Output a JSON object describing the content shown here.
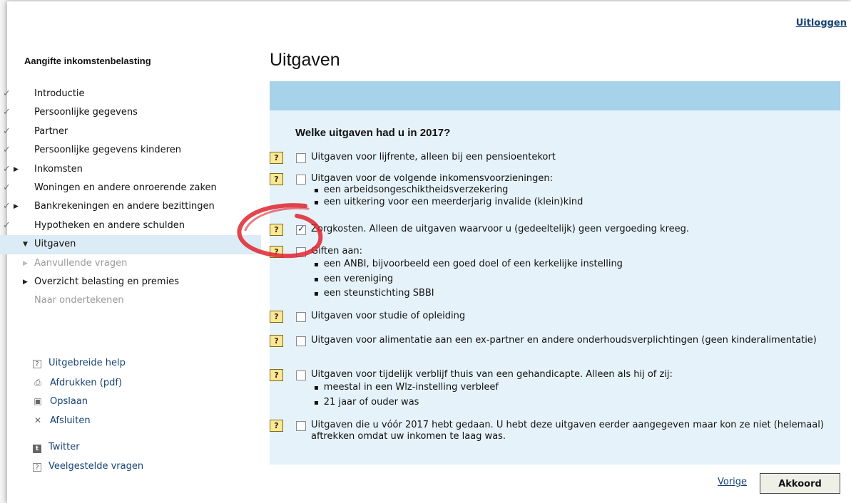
{
  "header": {
    "logout_label": "Uitloggen"
  },
  "sidebar": {
    "title": "Aangifte inkomstenbelasting",
    "items": [
      {
        "label": "Introductie",
        "check": "✓",
        "arrow": "",
        "state": "done"
      },
      {
        "label": "Persoonlijke gegevens",
        "check": "✓",
        "arrow": "",
        "state": "done"
      },
      {
        "label": "Partner",
        "check": "✓",
        "arrow": "",
        "state": "done"
      },
      {
        "label": "Persoonlijke gegevens kinderen",
        "check": "✓",
        "arrow": "",
        "state": "done"
      },
      {
        "label": "Inkomsten",
        "check": "✓",
        "arrow": "▶",
        "state": "done"
      },
      {
        "label": "Woningen en andere onroerende zaken",
        "check": "✓",
        "arrow": "",
        "state": "done"
      },
      {
        "label": "Bankrekeningen en andere bezittingen",
        "check": "✓",
        "arrow": "▶",
        "state": "done"
      },
      {
        "label": "Hypotheken en andere schulden",
        "check": "✓",
        "arrow": "",
        "state": "done"
      },
      {
        "label": "Uitgaven",
        "check": "",
        "arrow": "▼",
        "state": "active"
      },
      {
        "label": "Aanvullende vragen",
        "check": "",
        "arrow": "▶",
        "state": "disabled"
      },
      {
        "label": "Overzicht belasting en premies",
        "check": "",
        "arrow": "▶",
        "state": "normal"
      },
      {
        "label": "Naar ondertekenen",
        "check": "",
        "arrow": "",
        "state": "disabled"
      }
    ],
    "tools": [
      {
        "label": "Uitgebreide help",
        "icon": "help-icon",
        "glyph": "?"
      },
      {
        "label": "Afdrukken (pdf)",
        "icon": "print-icon",
        "glyph": "⎙"
      },
      {
        "label": "Opslaan",
        "icon": "save-icon",
        "glyph": "▣"
      },
      {
        "label": "Afsluiten",
        "icon": "close-icon",
        "glyph": "✕"
      }
    ],
    "links": [
      {
        "label": "Twitter",
        "icon": "twitter-icon",
        "glyph": "t"
      },
      {
        "label": "Veelgestelde vragen",
        "icon": "help-icon",
        "glyph": "?"
      }
    ]
  },
  "main": {
    "title": "Uitgaven",
    "question": "Welke uitgaven had u in 2017?",
    "help_glyph": "?",
    "options": [
      {
        "text": "Uitgaven voor lijfrente, alleen bij een pensioentekort",
        "checked": false,
        "bullets": []
      },
      {
        "text": "Uitgaven voor de volgende inkomensvoorzieningen:",
        "checked": false,
        "bullets": [
          "een arbeidsongeschiktheidsverzekering",
          "een uitkering voor een meerderjarig invalide (klein)kind"
        ]
      },
      {
        "text": "Zorgkosten. Alleen de uitgaven waarvoor u (gedeeltelijk) geen vergoeding kreeg.",
        "checked": true,
        "bullets": []
      },
      {
        "text": "Giften aan:",
        "checked": false,
        "bullets": [
          "een ANBI, bijvoorbeeld een goed doel of een kerkelijke instelling",
          "een vereniging",
          "een steunstichting SBBI"
        ]
      },
      {
        "text": "Uitgaven voor studie of opleiding",
        "checked": false,
        "bullets": []
      },
      {
        "text": "Uitgaven voor alimentatie aan een ex-partner en andere onderhoudsverplichtingen (geen kinderalimentatie)",
        "checked": false,
        "bullets": []
      },
      {
        "text": "Uitgaven voor tijdelijk verblijf thuis van een gehandicapte. Alleen als hij of zij:",
        "checked": false,
        "bullets": [
          "meestal in een Wlz-instelling verbleef",
          "21 jaar of ouder was"
        ]
      },
      {
        "text": "Uitgaven die u vóór 2017 hebt gedaan. U hebt deze uitgaven eerder aangegeven maar kon ze niet (helemaal) aftrekken omdat uw inkomen te laag was.",
        "checked": false,
        "bullets": []
      }
    ]
  },
  "footer": {
    "prev_label": "Vorige",
    "ok_label": "Akkoord"
  },
  "colors": {
    "accent_bar": "#a6d2ea",
    "panel": "#e5f2f9",
    "help_badge": "#fce891",
    "link": "#154273",
    "annotation": "#e0252e"
  }
}
